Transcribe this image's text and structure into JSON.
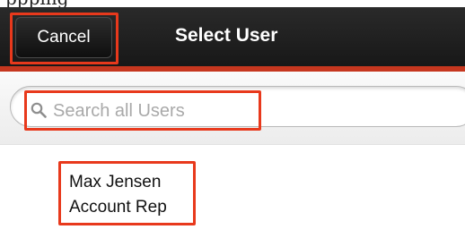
{
  "header": {
    "partial_caption": "ppping",
    "cancel_label": "Cancel",
    "title": "Select User"
  },
  "search": {
    "placeholder": "Search all Users",
    "icon": "search-icon"
  },
  "users": [
    {
      "name": "Max Jensen",
      "title": "Account Rep"
    }
  ],
  "colors": {
    "nav_background": "#1e1e1e",
    "accent_bar": "#c6371f",
    "highlight_outline": "#e8391c"
  }
}
